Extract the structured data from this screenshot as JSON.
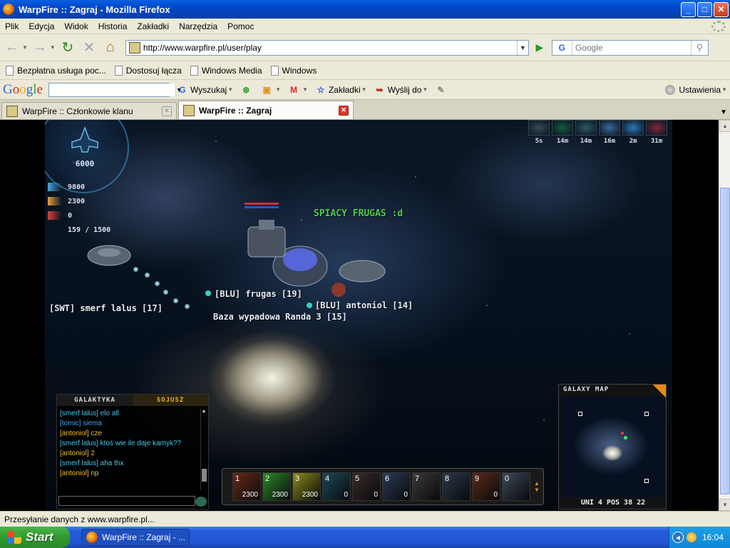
{
  "window": {
    "title": "WarpFire :: Zagraj - Mozilla Firefox",
    "btn_min": "_",
    "btn_max": "□",
    "btn_close": "✕"
  },
  "menu": [
    "Plik",
    "Edycja",
    "Widok",
    "Historia",
    "Zakładki",
    "Narzędzia",
    "Pomoc"
  ],
  "nav": {
    "url": "http://www.warpfire.pl/user/play",
    "search_engine": "G",
    "search_placeholder": "Google",
    "back_icon": "←",
    "forward_icon": "→",
    "reload_icon": "↻",
    "stop_icon": "✕",
    "home_icon": "⌂",
    "go_icon": "▶",
    "search_icon": "⚲"
  },
  "bookmarks": [
    "Bezpłatna usługa poc...",
    "Dostosuj łącza",
    "Windows Media",
    "Windows"
  ],
  "google_toolbar": {
    "logo": "Google",
    "search_label": "Wyszukaj",
    "bookmarks_label": "Zakładki",
    "send_label": "Wyślij do",
    "settings_label": "Ustawienia"
  },
  "tabs": [
    {
      "label": "WarpFire :: Członkowie klanu",
      "active": false
    },
    {
      "label": "WarpFire :: Zagraj",
      "active": true
    }
  ],
  "game": {
    "credits": "6000",
    "stats": [
      {
        "icon": "hull-icon",
        "value": "9800",
        "color": "#4aa8e0"
      },
      {
        "icon": "ammo-icon",
        "value": "2300",
        "color": "#e8a040"
      },
      {
        "icon": "rocket-icon",
        "value": "0",
        "color": "#d84040"
      },
      {
        "icon": "cargo-icon",
        "value": "159 / 1500",
        "color": ""
      }
    ],
    "top_icons": [
      {
        "label": "5s",
        "color": "#3a4a58"
      },
      {
        "label": "14m",
        "color": "#1a5a3a"
      },
      {
        "label": "14m",
        "color": "#2a5a6a"
      },
      {
        "label": "16m",
        "color": "#3a6a9a"
      },
      {
        "label": "2m",
        "color": "#2a7ab8"
      },
      {
        "label": "31m",
        "color": "#7a2a3a"
      }
    ],
    "labels": {
      "spiacy": "SPIACY FRUGAS :d",
      "frugas": "[BLU] frugas [19]",
      "antoniol": "[BLU] antoniol [14]",
      "smerf": "[SWT] smerf lalus [17]",
      "baza": "Baza wypadowa Randa 3 [15]"
    },
    "chat": {
      "tab_galaxy": "GALAKTYKA",
      "tab_alliance": "SOJUSZ",
      "lines": [
        {
          "text": "[smerf lalus] elo all",
          "color": "#4ac8e8"
        },
        {
          "text": "[tomic] siema",
          "color": "#4aa0e8"
        },
        {
          "text": "[antoniol] cze",
          "color": "#e8c040"
        },
        {
          "text": "[smerf lalus] ktoś wie ile daje kamyk??",
          "color": "#4ac8e8"
        },
        {
          "text": "[antoniol] 2",
          "color": "#e8c040"
        },
        {
          "text": "[smerf lalus] aha thx",
          "color": "#4ac8e8"
        },
        {
          "text": "[antoniol] np",
          "color": "#e8c040"
        }
      ]
    },
    "action_slots": [
      {
        "num": "1",
        "value": "2300",
        "color": "#6a2a1a"
      },
      {
        "num": "2",
        "value": "2300",
        "color": "#2a8a2a"
      },
      {
        "num": "3",
        "value": "2300",
        "color": "#8a8a1a"
      },
      {
        "num": "4",
        "value": "0",
        "color": "#1a4a5a"
      },
      {
        "num": "5",
        "value": "0",
        "color": "#3a2a2a"
      },
      {
        "num": "6",
        "value": "0",
        "color": "#2a3a5a"
      },
      {
        "num": "7",
        "value": "",
        "color": "#3a3a3a"
      },
      {
        "num": "8",
        "value": "",
        "color": "#2a3a4a"
      },
      {
        "num": "9",
        "value": "0",
        "color": "#5a2a1a"
      },
      {
        "num": "0",
        "value": "",
        "color": "#3a4a5a"
      }
    ],
    "galaxy_map": {
      "title": "GALAXY MAP",
      "position": "UNI 4 POS 38 22"
    }
  },
  "status_text": "Przesyłanie danych z www.warpfire.pl...",
  "taskbar": {
    "start": "Start",
    "task": "WarpFire :: Zagraj - ...",
    "clock": "16:04"
  }
}
